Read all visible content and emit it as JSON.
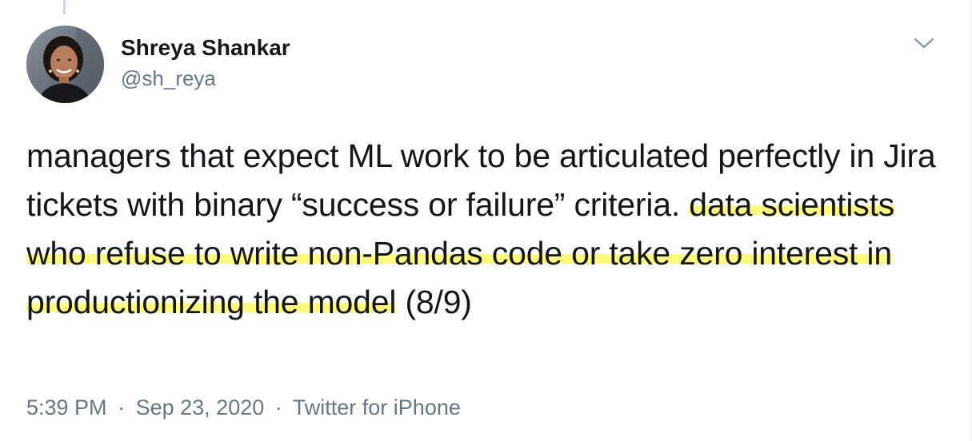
{
  "author": {
    "display_name": "Shreya Shankar",
    "handle": "@sh_reya"
  },
  "tweet": {
    "text_plain": "managers that expect ML work to be articulated perfectly in Jira tickets with binary “success or failure” criteria. ",
    "text_highlighted": "data scientists who refuse to write non-Pandas code or take zero interest in productionizing the model",
    "text_suffix": " (8/9)"
  },
  "meta": {
    "time": "5:39 PM",
    "date": "Sep 23, 2020",
    "source": "Twitter for iPhone",
    "separator": "·"
  },
  "icons": {
    "caret": "chevron-down-icon"
  },
  "colors": {
    "highlight": "#fffb7a",
    "secondary_text": "#657786",
    "primary_text": "#14171a",
    "border": "#e6ecf0"
  }
}
